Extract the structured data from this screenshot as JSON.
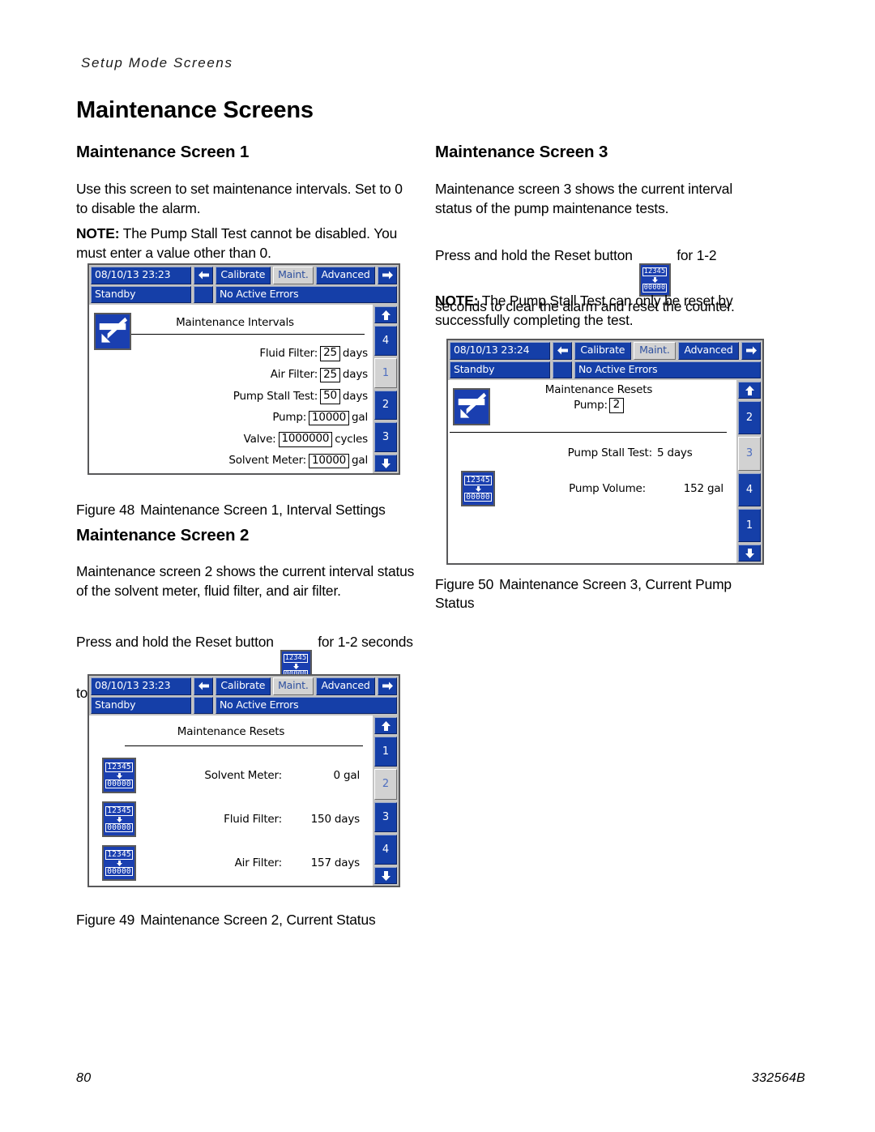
{
  "page": {
    "running_header": "Setup Mode Screens",
    "title": "Maintenance Screens",
    "footer_page_number": "80",
    "footer_doc_number": "332564B"
  },
  "colors": {
    "hmi_blue": "#153fa8",
    "hmi_selected": "#d2d2d2",
    "hmi_chrome": "#c3c3c3",
    "hmi_border": "#59595b",
    "icon_blue": "#1a3fb0"
  },
  "sections": {
    "screen1": {
      "heading": "Maintenance Screen 1",
      "paragraph1": "Use this screen to set maintenance intervals. Set to 0 to disable the alarm.",
      "note_label": "NOTE:",
      "note_text": " The Pump Stall Test cannot be disabled. You must enter a value other than 0.",
      "caption_number": "Figure 48",
      "caption_text": "Maintenance Screen 1, Interval Settings"
    },
    "screen2": {
      "heading": "Maintenance Screen 2",
      "paragraph1": "Maintenance screen 2 shows the current interval status of the solvent meter, fluid filter, and air filter.",
      "paragraph2_before": "Press and hold the Reset button",
      "paragraph2_after": "for 1-2 seconds to clear the alarm and reset the counter.",
      "caption_number": "Figure 49",
      "caption_text": "Maintenance Screen 2, Current Status"
    },
    "screen3": {
      "heading": "Maintenance Screen 3",
      "paragraph1": "Maintenance screen 3 shows the current interval status of the pump maintenance tests.",
      "paragraph2_before": "Press and hold the Reset button",
      "paragraph2_after": "for 1-2 seconds to clear the alarm and reset the counter.",
      "note_label": "NOTE:",
      "note_text": " The Pump Stall Test can only be reset by successfully completing the test.",
      "caption_number": "Figure 50",
      "caption_text": "Maintenance Screen 3, Current Pump Status"
    }
  },
  "hmi1": {
    "datetime": "08/10/13 23:23",
    "status": "Standby",
    "errors": "No Active Errors",
    "tabs": [
      {
        "label": "Calibrate",
        "selected": false
      },
      {
        "label": "Maint.",
        "selected": true
      },
      {
        "label": "Advanced",
        "selected": false
      }
    ],
    "screen_title": "Maintenance Intervals",
    "rail": [
      {
        "label": "4",
        "selected": false
      },
      {
        "label": "1",
        "selected": true
      },
      {
        "label": "2",
        "selected": false
      },
      {
        "label": "3",
        "selected": false
      }
    ],
    "fields": [
      {
        "label": "Fluid Filter:",
        "value": "25",
        "unit": "days"
      },
      {
        "label": "Air Filter:",
        "value": "25",
        "unit": "days"
      },
      {
        "label": "Pump Stall Test:",
        "value": "50",
        "unit": "days"
      },
      {
        "label": "Pump:",
        "value": "10000",
        "unit": "gal"
      },
      {
        "label": "Valve:",
        "value": "1000000",
        "unit": "cycles"
      },
      {
        "label": "Solvent Meter:",
        "value": "10000",
        "unit": "gal"
      }
    ]
  },
  "hmi2": {
    "datetime": "08/10/13 23:23",
    "status": "Standby",
    "errors": "No Active Errors",
    "tabs": [
      {
        "label": "Calibrate",
        "selected": false
      },
      {
        "label": "Maint.",
        "selected": true
      },
      {
        "label": "Advanced",
        "selected": false
      }
    ],
    "screen_title": "Maintenance Resets",
    "rail": [
      {
        "label": "1",
        "selected": false
      },
      {
        "label": "2",
        "selected": true
      },
      {
        "label": "3",
        "selected": false
      },
      {
        "label": "4",
        "selected": false
      }
    ],
    "rows": [
      {
        "label": "Solvent Meter:",
        "value": "0 gal"
      },
      {
        "label": "Fluid Filter:",
        "value": "150 days"
      },
      {
        "label": "Air Filter:",
        "value": "157 days"
      }
    ]
  },
  "hmi3": {
    "datetime": "08/10/13 23:24",
    "status": "Standby",
    "errors": "No Active Errors",
    "tabs": [
      {
        "label": "Calibrate",
        "selected": false
      },
      {
        "label": "Maint.",
        "selected": true
      },
      {
        "label": "Advanced",
        "selected": false
      }
    ],
    "screen_title": "Maintenance Resets",
    "pump_label": "Pump:",
    "pump_value": "2",
    "rail": [
      {
        "label": "2",
        "selected": false
      },
      {
        "label": "3",
        "selected": true
      },
      {
        "label": "4",
        "selected": false
      },
      {
        "label": "1",
        "selected": false
      }
    ],
    "stall_test_label": "Pump Stall Test:",
    "stall_test_value": "5 days",
    "pump_volume_label": "Pump Volume:",
    "pump_volume_value": "152 gal"
  },
  "icons": {
    "reset_top_digits": "12345",
    "reset_bottom_digits": "00000",
    "edit_icon_name": "edit-pencil-icon",
    "reset_icon_name": "counter-reset-icon"
  }
}
